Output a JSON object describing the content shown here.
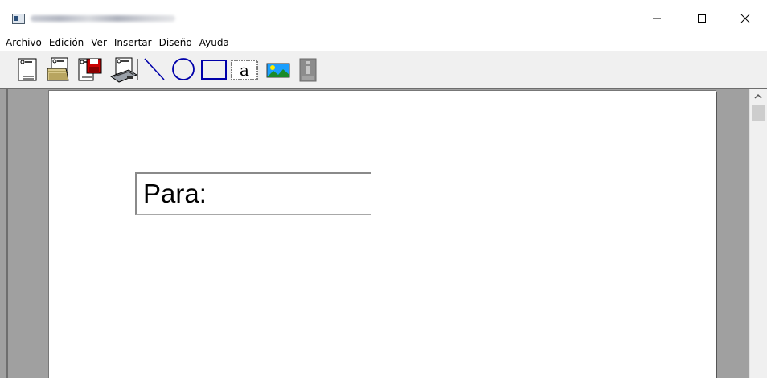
{
  "window": {
    "title_blurred": true
  },
  "menu": {
    "items": [
      {
        "label": "Archivo"
      },
      {
        "label": "Edición"
      },
      {
        "label": "Ver"
      },
      {
        "label": "Insertar"
      },
      {
        "label": "Diseño"
      },
      {
        "label": "Ayuda"
      }
    ]
  },
  "toolbar": {
    "tools": [
      {
        "icon": "new-document-icon"
      },
      {
        "icon": "open-folder-icon"
      },
      {
        "icon": "save-disk-icon"
      },
      {
        "icon": "print-icon"
      },
      {
        "icon": "line-tool-icon"
      },
      {
        "icon": "ellipse-tool-icon"
      },
      {
        "icon": "rectangle-tool-icon"
      },
      {
        "icon": "text-tool-icon",
        "glyph": "a"
      },
      {
        "icon": "image-tool-icon"
      },
      {
        "icon": "info-icon"
      }
    ]
  },
  "document": {
    "textbox_text": "Para:"
  },
  "colors": {
    "accent_blue": "#0000aa",
    "save_red": "#cc0000",
    "workspace_gray": "#a0a0a0"
  }
}
